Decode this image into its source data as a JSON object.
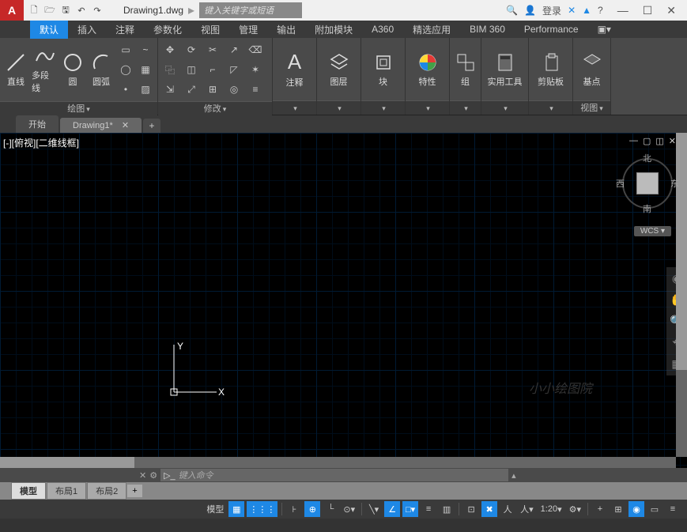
{
  "title": {
    "filename": "Drawing1.dwg",
    "search_placeholder": "键入关键字或短语",
    "login": "登录"
  },
  "menu": {
    "tabs": [
      "默认",
      "插入",
      "注释",
      "参数化",
      "视图",
      "管理",
      "输出",
      "附加模块",
      "A360",
      "精选应用",
      "BIM 360",
      "Performance"
    ]
  },
  "ribbon": {
    "draw": {
      "title": "绘图",
      "line": "直线",
      "polyline": "多段线",
      "circle": "圆",
      "arc": "圆弧"
    },
    "modify": {
      "title": "修改"
    },
    "annotate": {
      "title": "注释"
    },
    "layer": {
      "title": "图层"
    },
    "block": {
      "title": "块"
    },
    "properties": {
      "title": "特性"
    },
    "group": {
      "title": "组"
    },
    "utilities": {
      "title": "实用工具"
    },
    "clipboard": {
      "title": "剪贴板"
    },
    "base": {
      "title": "基点"
    },
    "view": {
      "title": "视图"
    }
  },
  "docTabs": {
    "start": "开始",
    "file": "Drawing1*"
  },
  "drawing": {
    "view_label": "[-][俯视][二维线框]",
    "axis_x": "X",
    "axis_y": "Y",
    "wcs": "WCS",
    "watermark": "小小绘图院",
    "cube": {
      "n": "北",
      "s": "南",
      "w": "西",
      "e": "东"
    }
  },
  "cmd": {
    "prompt": "▷_",
    "placeholder": "键入命令"
  },
  "layouts": {
    "model": "模型",
    "l1": "布局1",
    "l2": "布局2"
  },
  "status": {
    "model": "模型",
    "scale": "1:20"
  }
}
